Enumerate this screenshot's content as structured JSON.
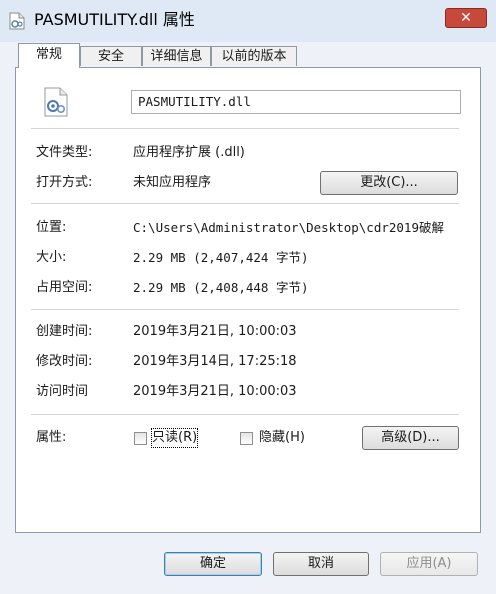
{
  "window": {
    "title": "PASMUTILITY.dll 属性",
    "close_label": "✕"
  },
  "tabs": [
    "常规",
    "安全",
    "详细信息",
    "以前的版本"
  ],
  "file": {
    "name": "PASMUTILITY.dll"
  },
  "general": {
    "type_label": "文件类型:",
    "type_value": "应用程序扩展 (.dll)",
    "opens_label": "打开方式:",
    "opens_value": "未知应用程序",
    "change_button": "更改(C)...",
    "location_label": "位置:",
    "location_value": "C:\\Users\\Administrator\\Desktop\\cdr2019破解",
    "size_label": "大小:",
    "size_value": "2.29 MB (2,407,424 字节)",
    "disk_size_label": "占用空间:",
    "disk_size_value": "2.29 MB (2,408,448 字节)",
    "created_label": "创建时间:",
    "created_value": "2019年3月21日, 10:00:03",
    "modified_label": "修改时间:",
    "modified_value": "2019年3月14日, 17:25:18",
    "accessed_label": "访问时间",
    "accessed_value": "2019年3月21日, 10:00:03",
    "attributes_label": "属性:",
    "readonly_label": "只读(R)",
    "hidden_label": "隐藏(H)",
    "advanced_button": "高级(D)..."
  },
  "footer": {
    "ok": "确定",
    "cancel": "取消",
    "apply": "应用(A)"
  }
}
